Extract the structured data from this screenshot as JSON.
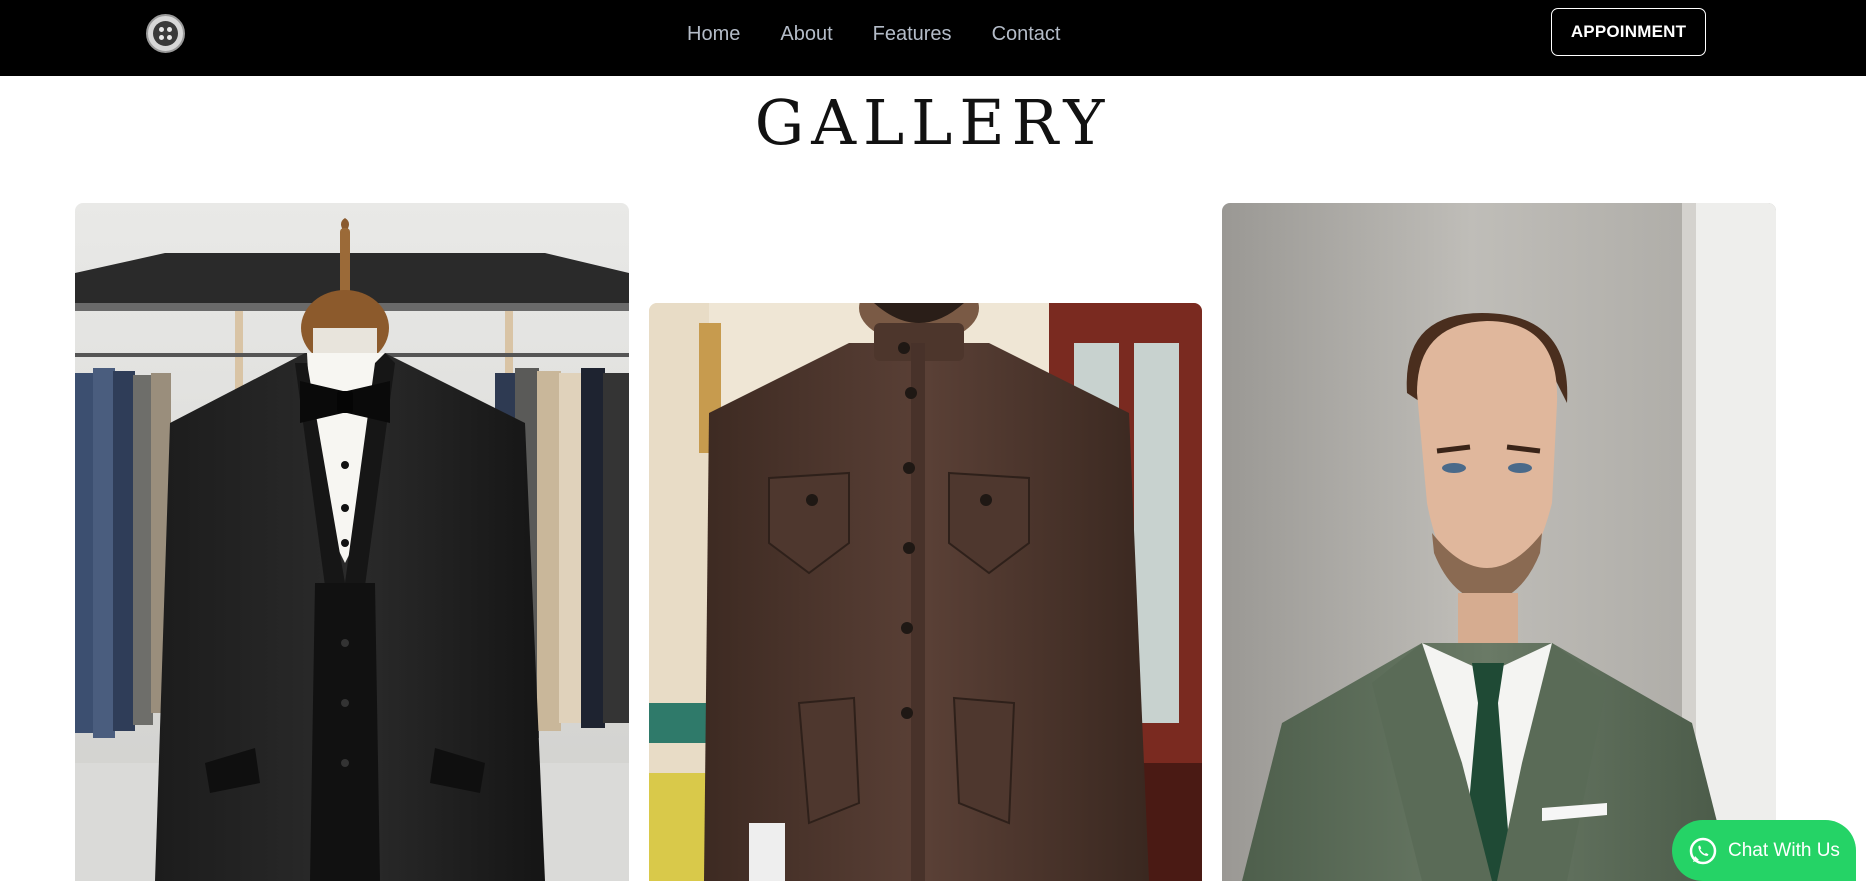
{
  "nav": {
    "logo": "coat-button-logo-icon",
    "links": [
      "Home",
      "About",
      "Features",
      "Contact"
    ],
    "cta": "APPOINMENT"
  },
  "gallery": {
    "title": "GALLERY",
    "photos": [
      {
        "subject": "black tuxedo with bow tie on wooden mannequin in a suit shop"
      },
      {
        "subject": "brown bandhgala jacket with flap pockets worn by a bearded man"
      },
      {
        "subject": "man in green suit with dark green tie and white pocket square"
      }
    ]
  },
  "chat": {
    "label": "Chat With Us",
    "icon": "whatsapp-icon",
    "color": "#25d366"
  }
}
